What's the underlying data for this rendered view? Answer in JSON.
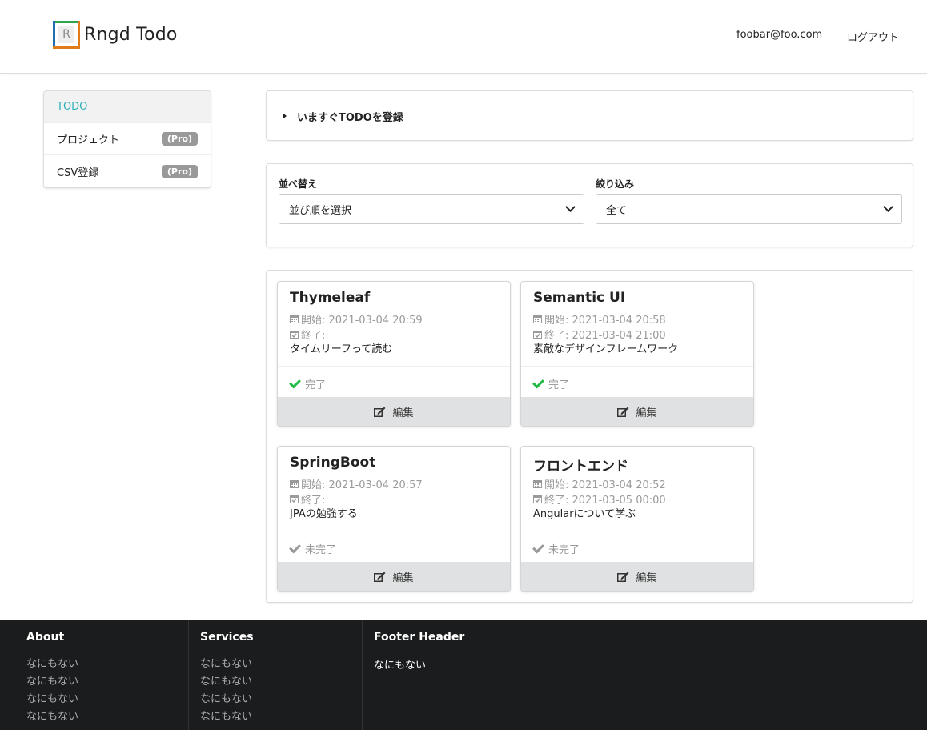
{
  "header": {
    "logo_letter": "R",
    "app_title": "Rngd Todo",
    "user_email": "foobar@foo.com",
    "logout_label": "ログアウト"
  },
  "sidebar": {
    "items": [
      {
        "label": "TODO",
        "active": true
      },
      {
        "label": "プロジェクト",
        "badge": "(Pro)"
      },
      {
        "label": "CSV登録",
        "badge": "(Pro)"
      }
    ]
  },
  "register": {
    "title": "いますぐTODOを登録"
  },
  "filters": {
    "sort_label": "並べ替え",
    "sort_value": "並び順を選択",
    "filter_label": "絞り込み",
    "filter_value": "全て"
  },
  "cards": [
    {
      "title": "Thymeleaf",
      "start": "開始: 2021-03-04 20:59",
      "end": "終了:",
      "description": "タイムリーフって読む",
      "status": "完了",
      "done": true,
      "edit_label": "編集"
    },
    {
      "title": "Semantic UI",
      "start": "開始: 2021-03-04 20:58",
      "end": "終了: 2021-03-04 21:00",
      "description": "素敵なデザインフレームワーク",
      "status": "完了",
      "done": true,
      "edit_label": "編集"
    },
    {
      "title": "SpringBoot",
      "start": "開始: 2021-03-04 20:57",
      "end": "終了:",
      "description": "JPAの勉強する",
      "status": "未完了",
      "done": false,
      "edit_label": "編集"
    },
    {
      "title": "フロントエンド",
      "start": "開始: 2021-03-04 20:52",
      "end": "終了: 2021-03-05 00:00",
      "description": "Angularについて学ぶ",
      "status": "未完了",
      "done": false,
      "edit_label": "編集"
    }
  ],
  "footer": {
    "about": {
      "header": "About",
      "links": [
        "なにもない",
        "なにもない",
        "なにもない",
        "なにもない"
      ]
    },
    "services": {
      "header": "Services",
      "links": [
        "なにもない",
        "なにもない",
        "なにもない",
        "なにもない"
      ]
    },
    "footer_header": {
      "header": "Footer Header",
      "text": "なにもない"
    }
  },
  "colors": {
    "accent_teal": "#2bb0b7",
    "done_green": "#21ba45",
    "footer_bg": "#1b1c1d"
  }
}
